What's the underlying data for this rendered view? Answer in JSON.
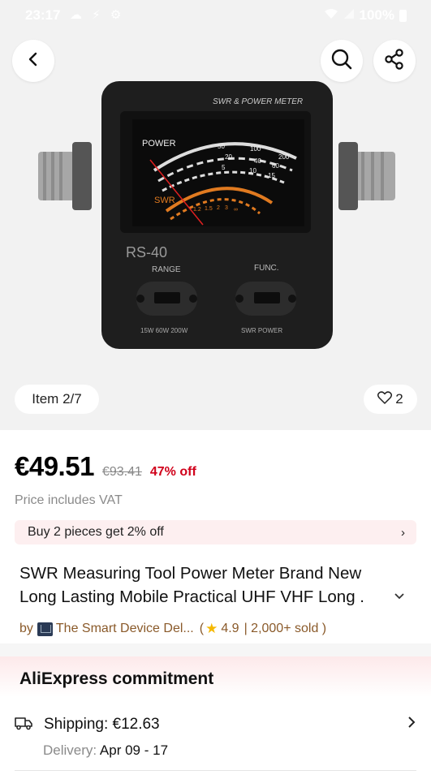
{
  "status_bar": {
    "time": "23:17",
    "battery": "100%"
  },
  "hero": {
    "item_counter": "Item 2/7",
    "wishlist_count": "2",
    "icons": [
      "back-arrow-icon",
      "search-icon",
      "share-icon",
      "heart-icon"
    ]
  },
  "product_image_text": {
    "header": "SWR & POWER METER",
    "meter_power": "POWER",
    "meter_swr": "SWR",
    "model": "RS-40",
    "range_label": "RANGE",
    "func_label": "FUNC.",
    "range_options": "15W 60W 200W",
    "func_options": "SWR   POWER",
    "scale_top": [
      "50",
      "100",
      "200"
    ],
    "scale_mid": [
      "20",
      "40",
      "60"
    ],
    "scale_low": [
      "5",
      "10",
      "15"
    ],
    "swr_scale": [
      "1.2",
      "1.5",
      "2",
      "3",
      "∞"
    ]
  },
  "price": {
    "current": "€49.51",
    "original": "€93.41",
    "discount": "47% off",
    "vat_note": "Price includes VAT"
  },
  "promo": {
    "text": "Buy 2 pieces get 2% off",
    "chevron": "›"
  },
  "product": {
    "title": "SWR Measuring Tool Power Meter Brand New Long Lasting Mobile Practical UHF VHF Long ."
  },
  "seller": {
    "by": "by",
    "name": "The Smart Device Del...",
    "open": "(",
    "rating": "4.9",
    "sold": "| 2,000+ sold )"
  },
  "commitment": {
    "title": "AliExpress commitment",
    "shipping_label": "Shipping: €12.63",
    "delivery_label": "Delivery:",
    "delivery_value": "Apr 09 - 17"
  },
  "colors": {
    "accent_red": "#d0021b",
    "promo_bg": "#fdeff0",
    "seller_brown": "#8a5a2a",
    "star": "#f5b800"
  }
}
